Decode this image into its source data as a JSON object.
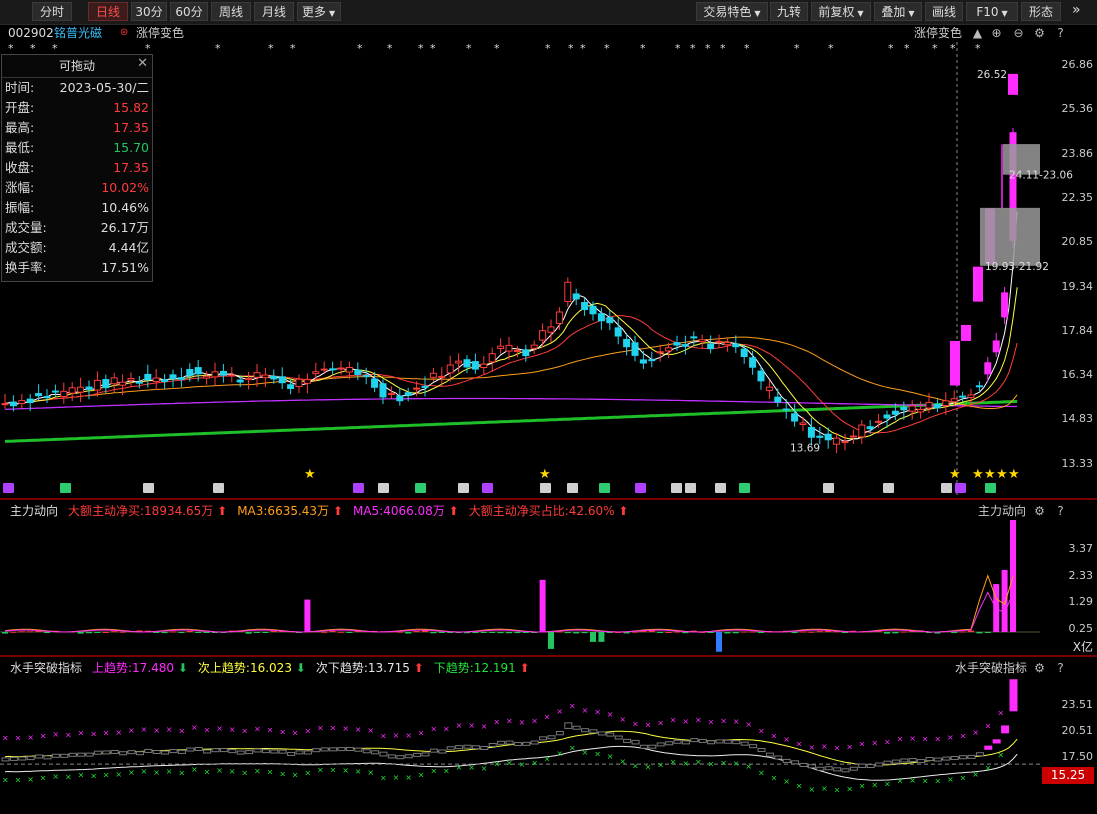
{
  "toolbar": {
    "left": [
      "分时",
      "日线",
      "30分",
      "60分",
      "周线",
      "月线",
      "更多"
    ],
    "right": [
      "交易特色",
      "九转",
      "前复权",
      "叠加",
      "画线",
      "F10",
      "形态"
    ]
  },
  "stock": {
    "code": "002902",
    "name": "铭普光磁",
    "indicator": "涨停变色"
  },
  "info": {
    "title": "可拖动",
    "rows": [
      {
        "k": "时间:",
        "v": "2023-05-30/二",
        "c": "#ddd"
      },
      {
        "k": "开盘:",
        "v": "15.82",
        "c": "#ff3b3b"
      },
      {
        "k": "最高:",
        "v": "17.35",
        "c": "#ff3b3b"
      },
      {
        "k": "最低:",
        "v": "15.70",
        "c": "#22c55e"
      },
      {
        "k": "收盘:",
        "v": "17.35",
        "c": "#ff3b3b"
      },
      {
        "k": "涨幅:",
        "v": "10.02%",
        "c": "#ff3b3b"
      },
      {
        "k": "振幅:",
        "v": "10.46%",
        "c": "#ddd"
      },
      {
        "k": "成交量:",
        "v": "26.17万",
        "c": "#ddd"
      },
      {
        "k": "成交额:",
        "v": "4.44亿",
        "c": "#ddd"
      },
      {
        "k": "换手率:",
        "v": "17.51%",
        "c": "#ddd"
      }
    ]
  },
  "main_chart": {
    "y_ticks": [
      "26.86",
      "25.36",
      "23.86",
      "22.35",
      "20.85",
      "19.34",
      "17.84",
      "16.34",
      "14.83",
      "13.33"
    ],
    "annotations": {
      "high": "26.52",
      "low": "13.69",
      "box_upper": "24.11-23.06",
      "box_lower": "19.93-21.92"
    },
    "right_label": "涨停变色"
  },
  "flow_panel": {
    "title": "主力动向",
    "items": [
      {
        "t": "大额主动净买:18934.65万",
        "c": "#ff3b3b"
      },
      {
        "t": "MA3:6635.43万",
        "c": "#ff9f1a"
      },
      {
        "t": "MA5:4066.08万",
        "c": "#ff2bff"
      },
      {
        "t": "大额主动净买占比:42.60%",
        "c": "#ff3b3b"
      }
    ],
    "right_label": "主力动向",
    "y_ticks": [
      "3.37",
      "2.33",
      "1.29",
      "0.25"
    ],
    "unit": "X亿"
  },
  "sailor_panel": {
    "title": "水手突破指标",
    "items": [
      {
        "t": "上趋势:17.480",
        "c": "#ff2bff",
        "arrow": "down"
      },
      {
        "t": "次上趋势:16.023",
        "c": "#ffff40",
        "arrow": "down"
      },
      {
        "t": "次下趋势:13.715",
        "c": "#e6e6e6",
        "arrow": "up"
      },
      {
        "t": "下趋势:12.191",
        "c": "#22e03a",
        "arrow": "up"
      }
    ],
    "right_label": "水手突破指标",
    "y_ticks": [
      "23.51",
      "20.51",
      "17.50"
    ],
    "current": "15.25"
  },
  "colors": {
    "up": "#ff3b3b",
    "down": "#22d3ee",
    "limit": "#ff2bff",
    "ma5": "#ffffff",
    "ma10": "#ffff40",
    "ma20": "#ff3b3b",
    "ma60": "#ff9f1a",
    "ma120": "#c030ff",
    "ma250": "#1fbf2a"
  }
}
